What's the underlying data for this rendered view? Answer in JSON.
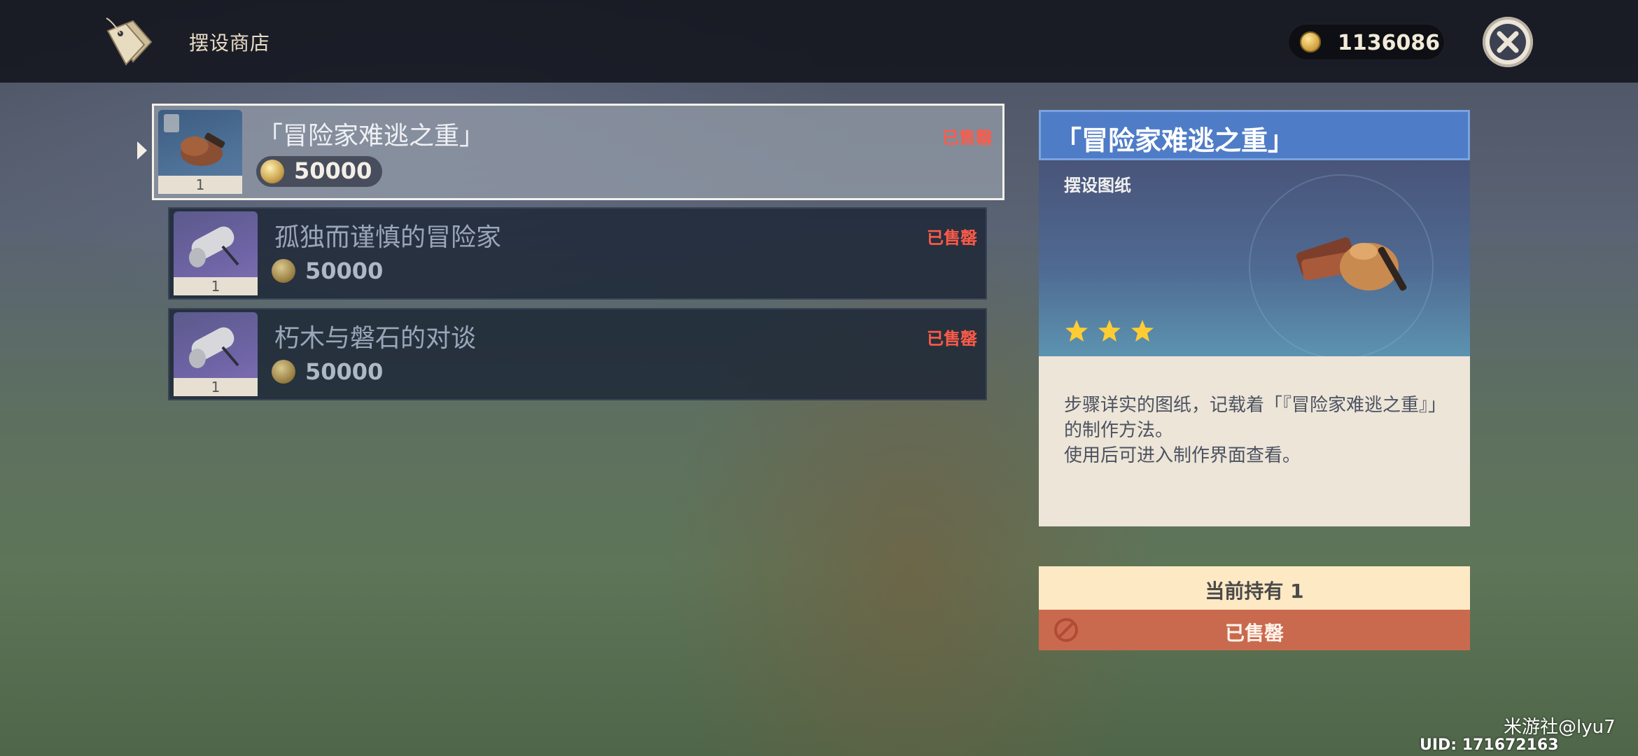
{
  "header": {
    "title": "摆设商店",
    "currency_amount": "1136086"
  },
  "shop_items": [
    {
      "name": "「冒险家难逃之重」",
      "price": "50000",
      "status": "已售罄",
      "quantity": "1",
      "selected": true
    },
    {
      "name": "孤独而谨慎的冒险家",
      "price": "50000",
      "status": "已售罄",
      "quantity": "1",
      "selected": false
    },
    {
      "name": "朽木与磐石的对谈",
      "price": "50000",
      "status": "已售罄",
      "quantity": "1",
      "selected": false
    }
  ],
  "detail": {
    "title": "「冒险家难逃之重」",
    "category": "摆设图纸",
    "rarity_stars": 3,
    "description_line1": "步骤详实的图纸，记载着「『冒险家难逃之重』」的制作方法。",
    "description_line2": "使用后可进入制作界面查看。"
  },
  "footer": {
    "holding": "当前持有 1",
    "action": "已售罄"
  },
  "overlay": {
    "watermark": "米游社@lyu7",
    "uid": "UID: 171672163"
  },
  "colors": {
    "sold_red": "#ff5a48",
    "detail_header": "#4f7cc7",
    "action_button": "#c96a4e",
    "holding_bar": "#fde9c4"
  }
}
